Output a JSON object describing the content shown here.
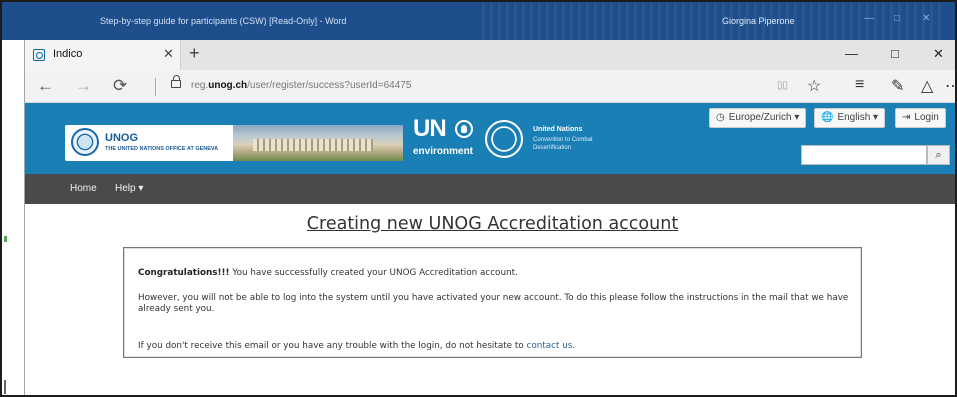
{
  "word": {
    "title": "Step-by-step guide for participants (CSW) [Read-Only]  -  Word",
    "user": "Giorgina Piperone",
    "controls": [
      "—",
      "□",
      "✕"
    ]
  },
  "browser": {
    "tab_label": "Indico",
    "tab_close": "✕",
    "new_tab": "+",
    "win_min": "—",
    "win_max": "□",
    "win_close": "✕",
    "back": "←",
    "forward": "→",
    "refresh": "⟳",
    "url_prefix": "reg.",
    "url_domain": "unog.ch",
    "url_path": "/user/register/success?userId=64475",
    "reading_view": "▯▯",
    "favorite": "☆",
    "hub": "≡",
    "notes": "✎",
    "share": "△",
    "more": "⋯"
  },
  "header": {
    "unog": "UNOG",
    "unog_sub": "THE UNITED NATIONS OFFICE AT GENEVA",
    "un_env_un": "UN",
    "un_env_word": "environment",
    "unccd_title": "United Nations",
    "unccd_sub": "Convention to Combat Desertification",
    "timezone": "Europe/Zurich",
    "language": "English",
    "login": "Login",
    "search_value": "",
    "search_icon": "⌕"
  },
  "nav": {
    "home": "Home",
    "help": "Help"
  },
  "content": {
    "title": "Creating new UNOG Accreditation account",
    "congrats": "Congratulations!!!",
    "created": " You have successfully created your UNOG Accreditation account.",
    "line2": "However, you will not be able to log into the system until you have activated your new account. To do this please follow the instructions in the mail that we have already sent you.",
    "line3_pre": "If you don't receive this email or you have any trouble with the login, do not hesitate to ",
    "contact_link": "contact us",
    "line3_post": "."
  },
  "colors": {
    "header_blue": "#1a7fb4",
    "nav_gray": "#4a4a4a",
    "link": "#2a6496",
    "word_blue": "#1f4e8c"
  }
}
